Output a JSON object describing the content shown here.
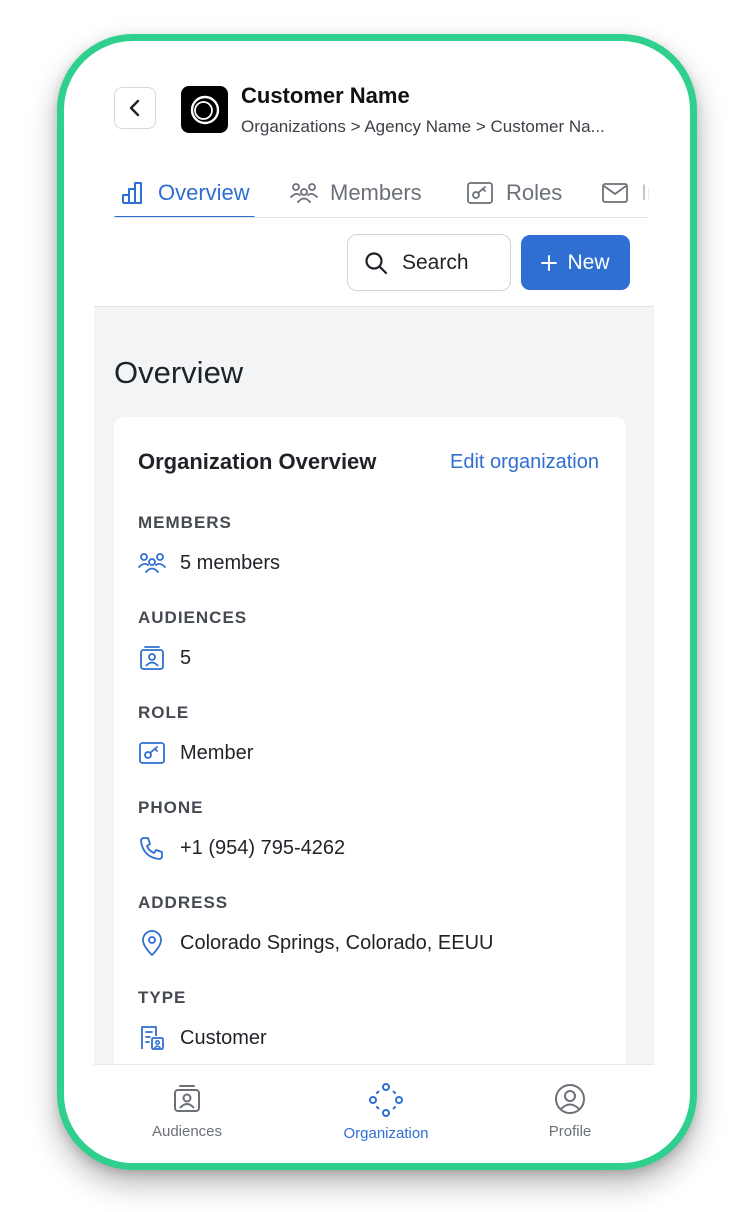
{
  "header": {
    "title": "Customer Name",
    "breadcrumb": "Organizations > Agency Name > Customer Na..."
  },
  "tabs": [
    {
      "label": "Overview",
      "icon": "chart-icon",
      "active": true
    },
    {
      "label": "Members",
      "icon": "members-icon"
    },
    {
      "label": "Roles",
      "icon": "role-icon"
    },
    {
      "label": "In",
      "icon": "mail-icon"
    }
  ],
  "actions": {
    "search_label": "Search",
    "new_label": "New"
  },
  "main": {
    "heading": "Overview",
    "card": {
      "title": "Organization Overview",
      "edit_label": "Edit organization",
      "fields": [
        {
          "label": "MEMBERS",
          "value": "5 members",
          "icon": "members-icon"
        },
        {
          "label": "AUDIENCES",
          "value": "5",
          "icon": "audience-icon"
        },
        {
          "label": "ROLE",
          "value": "Member",
          "icon": "role-key-icon"
        },
        {
          "label": "PHONE",
          "value": "+1 (954) 795-4262",
          "icon": "phone-icon"
        },
        {
          "label": "ADDRESS",
          "value": "Colorado Springs, Colorado, EEUU",
          "icon": "location-pin-icon"
        },
        {
          "label": "TYPE",
          "value": "Customer",
          "icon": "building-user-icon"
        }
      ]
    }
  },
  "bottom_nav": [
    {
      "label": "Audiences",
      "icon": "audience-icon"
    },
    {
      "label": "Organization",
      "icon": "organization-icon",
      "active": true
    },
    {
      "label": "Profile",
      "icon": "profile-icon"
    }
  ],
  "colors": {
    "accent": "#2f6fd1",
    "frame": "#2fd08e",
    "content_bg": "#f3f4f6"
  }
}
